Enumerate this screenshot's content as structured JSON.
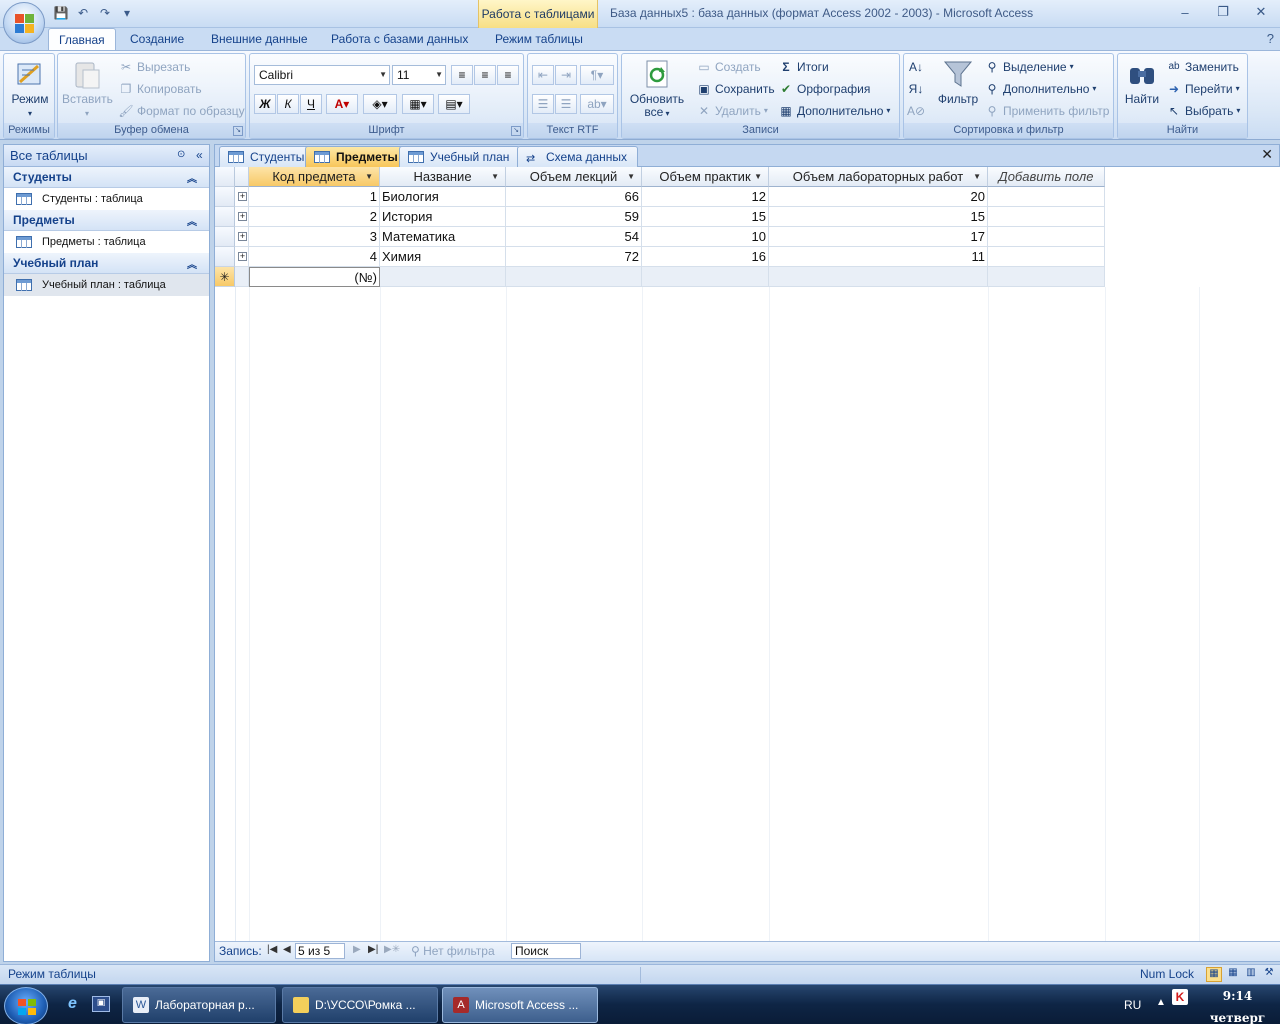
{
  "titlebar": {
    "context_group": "Работа с таблицами",
    "window_title": "База данных5 : база данных (формат Access 2002 - 2003) - Microsoft Access",
    "minimize": "‒",
    "maximize": "❐",
    "close": "✕"
  },
  "qat": {
    "save": "💾",
    "undo": "↶",
    "redo": "↷",
    "more": "▾"
  },
  "ribbon_tabs": [
    "Главная",
    "Создание",
    "Внешние данные",
    "Работа с базами данных",
    "Режим таблицы"
  ],
  "ribbon": {
    "modes": {
      "label": "Режимы",
      "mode_btn": "Режим"
    },
    "clipboard": {
      "label": "Буфер обмена",
      "paste": "Вставить",
      "cut": "Вырезать",
      "copy": "Копировать",
      "format_painter": "Формат по образцу"
    },
    "font": {
      "label": "Шрифт",
      "family": "Calibri",
      "size": "11",
      "bold": "Ж",
      "italic": "К",
      "underline": "Ч"
    },
    "rtf": {
      "label": "Текст RTF"
    },
    "records": {
      "label": "Записи",
      "refresh_all_1": "Обновить",
      "refresh_all_2": "все",
      "new": "Создать",
      "save": "Сохранить",
      "delete": "Удалить",
      "totals": "Итоги",
      "spelling": "Орфография",
      "more": "Дополнительно"
    },
    "sort_filter": {
      "label": "Сортировка и фильтр",
      "filter": "Фильтр",
      "selection": "Выделение",
      "advanced": "Дополнительно",
      "apply_filter": "Применить фильтр"
    },
    "find": {
      "label": "Найти",
      "find": "Найти",
      "replace": "Заменить",
      "goto": "Перейти",
      "select": "Выбрать"
    }
  },
  "nav": {
    "header": "Все таблицы",
    "sections": [
      {
        "title": "Студенты",
        "item": "Студенты : таблица"
      },
      {
        "title": "Предметы",
        "item": "Предметы : таблица"
      },
      {
        "title": "Учебный план",
        "item": "Учебный план : таблица"
      }
    ]
  },
  "doc_tabs": [
    "Студенты",
    "Предметы",
    "Учебный план",
    "Схема данных"
  ],
  "grid": {
    "headers": [
      "Код предмета",
      "Название",
      "Объем лекций",
      "Объем практик",
      "Объем лабораторных работ",
      "Добавить поле"
    ],
    "rows": [
      [
        "1",
        "Биология",
        "66",
        "12",
        "20"
      ],
      [
        "2",
        "История",
        "59",
        "15",
        "15"
      ],
      [
        "3",
        "Математика",
        "54",
        "10",
        "17"
      ],
      [
        "4",
        "Химия",
        "72",
        "16",
        "11"
      ]
    ],
    "new_row_placeholder": "(№)",
    "new_row_marker": "✳"
  },
  "record_nav": {
    "label": "Запись:",
    "position": "5 из 5",
    "filter": "Нет фильтра",
    "search": "Поиск"
  },
  "status": {
    "mode": "Режим таблицы",
    "numlock": "Num Lock"
  },
  "taskbar": {
    "buttons": [
      "Лабораторная р...",
      "D:\\УССО\\Ромка ...",
      "Microsoft Access ..."
    ],
    "lang": "RU",
    "time": "9:14",
    "day": "четверг"
  }
}
